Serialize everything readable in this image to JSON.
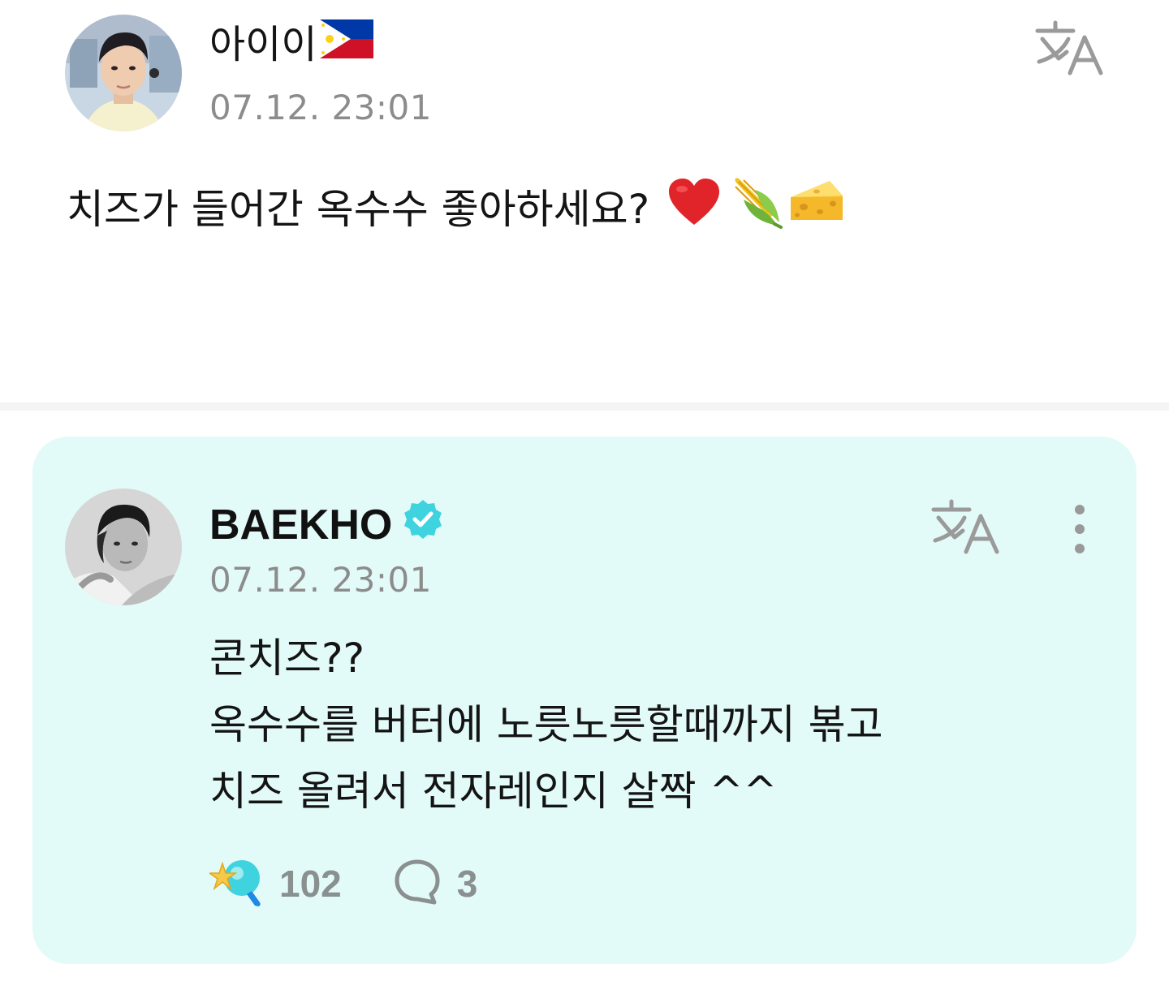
{
  "post": {
    "author": "아이이",
    "flag_icon": "philippines-flag-icon",
    "timestamp": "07.12. 23:01",
    "body": "치즈가 들어간 옥수수 좋아하세요?",
    "emojis": [
      "heart-emoji",
      "corn-emoji",
      "cheese-emoji"
    ],
    "translate_icon": "translate-icon"
  },
  "reply": {
    "author": "BAEKHO",
    "verified_icon": "verified-badge-icon",
    "timestamp": "07.12. 23:01",
    "lines": [
      "콘치즈??",
      "옥수수를 버터에 노릇노릇할때까지 볶고",
      "치즈 올려서 전자레인지 살짝 ^^"
    ],
    "like_count": "102",
    "comment_count": "3",
    "card_color": "#e3fbf8",
    "accent_color": "#3fd3e0"
  }
}
